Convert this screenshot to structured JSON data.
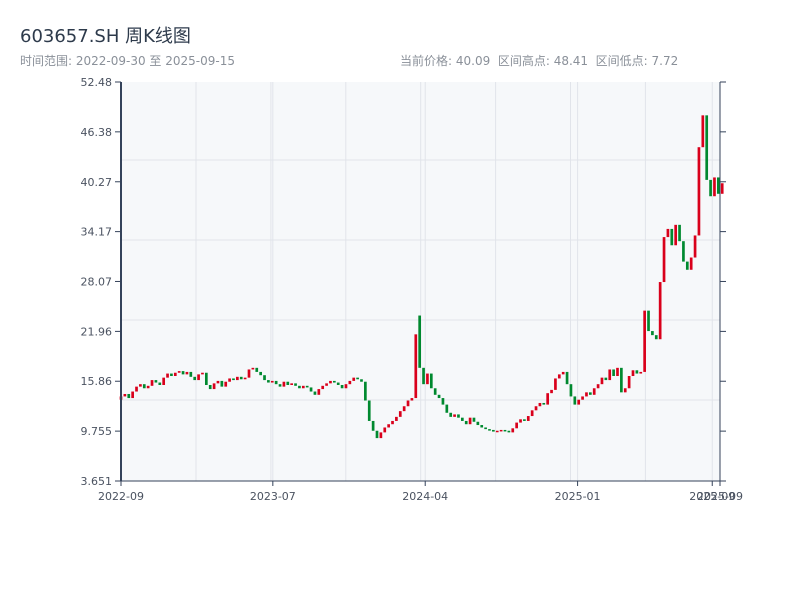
{
  "title": "603657.SH 周K线图",
  "range_text": "时间范围: 2022-09-30 至 2025-09-15",
  "stats_text": "当前价格: 40.09  区间高点: 48.41  区间低点: 7.72",
  "colors": {
    "up": "#d9001b",
    "down": "#00892f",
    "axis": "#34425a",
    "grid": "#e1e4ea",
    "plot_bg": "#f6f8fa"
  },
  "chart_data": {
    "type": "candlestick",
    "frequency": "weekly",
    "start_date": "2022-09-30",
    "end_date": "2025-09-15",
    "ylim": [
      3.651,
      52.48
    ],
    "y_ticks": [
      "52.48",
      "46.38",
      "40.27",
      "34.17",
      "28.07",
      "21.96",
      "15.86",
      "9.755",
      "3.651"
    ],
    "x_ticks": [
      "2022-09",
      "2023-07",
      "2024-04",
      "2025-01",
      "2025-09",
      "2025-09"
    ],
    "grid": true,
    "open": [
      13.6,
      14.0,
      14.3,
      13.8,
      14.6,
      15.2,
      15.5,
      15.0,
      15.3,
      16.0,
      15.7,
      15.4,
      16.3,
      16.8,
      16.5,
      16.9,
      17.1,
      16.7,
      17.0,
      16.4,
      16.0,
      16.7,
      16.9,
      15.4,
      14.9,
      15.6,
      15.9,
      15.2,
      15.8,
      16.2,
      16.0,
      16.4,
      16.1,
      16.3,
      17.3,
      17.5,
      17.0,
      16.6,
      16.0,
      15.7,
      15.9,
      15.5,
      15.2,
      15.8,
      15.4,
      15.6,
      15.3,
      15.0,
      15.3,
      15.1,
      14.6,
      14.2,
      14.9,
      15.3,
      15.6,
      15.9,
      15.7,
      15.4,
      15.0,
      15.5,
      15.9,
      16.3,
      16.1,
      15.8,
      13.5,
      11.0,
      9.8,
      8.9,
      9.6,
      10.2,
      10.6,
      11.0,
      11.5,
      12.2,
      12.8,
      13.5,
      13.8,
      23.9,
      17.5,
      15.5,
      16.8,
      15.0,
      14.2,
      13.8,
      13.0,
      12.0,
      11.5,
      11.8,
      11.4,
      11.0,
      10.6,
      11.4,
      10.9,
      10.5,
      10.2,
      10.0,
      9.9,
      9.7,
      9.8,
      9.9,
      9.8,
      9.6,
      10.1,
      10.8,
      11.2,
      11.0,
      11.6,
      12.3,
      12.8,
      13.2,
      13.0,
      14.4,
      14.8,
      16.2,
      16.7,
      17.0,
      15.5,
      14.0,
      13.0,
      13.6,
      14.0,
      14.5,
      14.2,
      15.0,
      15.5,
      16.3,
      16.0,
      17.3,
      16.5,
      17.5,
      14.5,
      15.0,
      16.5,
      17.2,
      16.8,
      17.0,
      24.5,
      22.0,
      21.5,
      21.0,
      28.0,
      33.5,
      34.5,
      32.5,
      35.0,
      33.0,
      30.5,
      29.5,
      31.0,
      33.7,
      44.5,
      48.4,
      40.5,
      38.5,
      40.8,
      38.8
    ],
    "close": [
      14.0,
      14.3,
      13.8,
      14.6,
      15.2,
      15.5,
      15.0,
      15.3,
      16.0,
      15.7,
      15.4,
      16.3,
      16.8,
      16.5,
      16.9,
      17.1,
      16.7,
      17.0,
      16.4,
      16.0,
      16.7,
      16.9,
      15.4,
      14.9,
      15.6,
      15.9,
      15.2,
      15.8,
      16.2,
      16.0,
      16.4,
      16.1,
      16.3,
      17.3,
      17.5,
      17.0,
      16.6,
      16.0,
      15.7,
      15.9,
      15.5,
      15.2,
      15.8,
      15.4,
      15.6,
      15.3,
      15.0,
      15.3,
      15.1,
      14.6,
      14.2,
      14.9,
      15.3,
      15.6,
      15.9,
      15.7,
      15.4,
      15.0,
      15.5,
      15.9,
      16.3,
      16.1,
      15.8,
      13.5,
      11.0,
      9.8,
      8.9,
      9.6,
      10.2,
      10.6,
      11.0,
      11.5,
      12.2,
      12.8,
      13.5,
      13.8,
      21.6,
      17.5,
      15.5,
      16.8,
      15.0,
      14.2,
      13.8,
      13.0,
      12.0,
      11.5,
      11.8,
      11.4,
      11.0,
      10.6,
      11.4,
      10.9,
      10.5,
      10.2,
      10.0,
      9.9,
      9.7,
      9.8,
      9.9,
      9.8,
      9.6,
      10.1,
      10.8,
      11.2,
      11.0,
      11.6,
      12.3,
      12.8,
      13.2,
      13.0,
      14.4,
      14.8,
      16.2,
      16.7,
      17.0,
      15.5,
      14.0,
      13.0,
      13.6,
      14.0,
      14.5,
      14.2,
      15.0,
      15.5,
      16.3,
      16.0,
      17.3,
      16.5,
      17.5,
      14.5,
      15.0,
      16.5,
      17.2,
      16.8,
      17.0,
      24.5,
      22.0,
      21.5,
      21.0,
      28.0,
      33.5,
      34.5,
      32.5,
      35.0,
      33.0,
      30.5,
      29.5,
      31.0,
      33.7,
      44.5,
      48.4,
      40.5,
      38.5,
      40.8,
      38.8,
      40.09
    ]
  }
}
